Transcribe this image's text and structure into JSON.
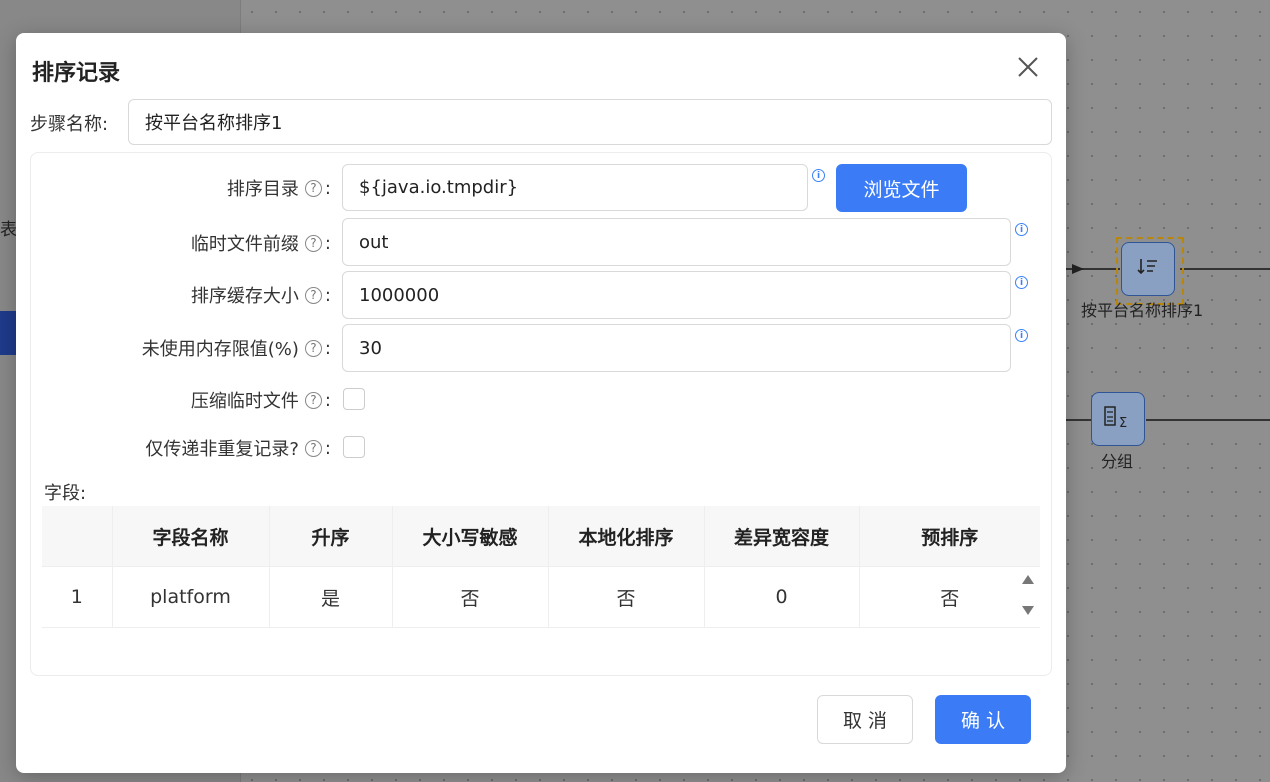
{
  "background": {
    "left_partial_text": "表",
    "nodes": [
      {
        "label": "按平台名称排序1",
        "icon": "sort-icon"
      },
      {
        "label": "分组",
        "icon": "group-sum-icon"
      }
    ]
  },
  "dialog": {
    "title": "排序记录",
    "step_name_label": "步骤名称",
    "step_name_value": "按平台名称排序1",
    "fields": {
      "sort_dir_label": "排序目录",
      "sort_dir_value": "${java.io.tmpdir}",
      "browse_label": "浏览文件",
      "temp_prefix_label": "临时文件前缀",
      "temp_prefix_value": "out",
      "cache_size_label": "排序缓存大小",
      "cache_size_value": "1000000",
      "free_memory_label": "未使用内存限值(%)",
      "free_memory_value": "30",
      "compress_label": "压缩临时文件",
      "compress_checked": false,
      "unique_label": "仅传递非重复记录?",
      "unique_checked": false
    },
    "fields_section_label": "字段:",
    "table": {
      "headers": [
        "",
        "字段名称",
        "升序",
        "大小写敏感",
        "本地化排序",
        "差异宽容度",
        "预排序"
      ],
      "rows": [
        [
          "1",
          "platform",
          "是",
          "否",
          "否",
          "0",
          "否"
        ]
      ]
    },
    "cancel_label": "取 消",
    "confirm_label": "确 认"
  },
  "colors": {
    "primary": "#3b7cf6",
    "info": "#3b82f6",
    "selection_border": "#b8860b"
  }
}
